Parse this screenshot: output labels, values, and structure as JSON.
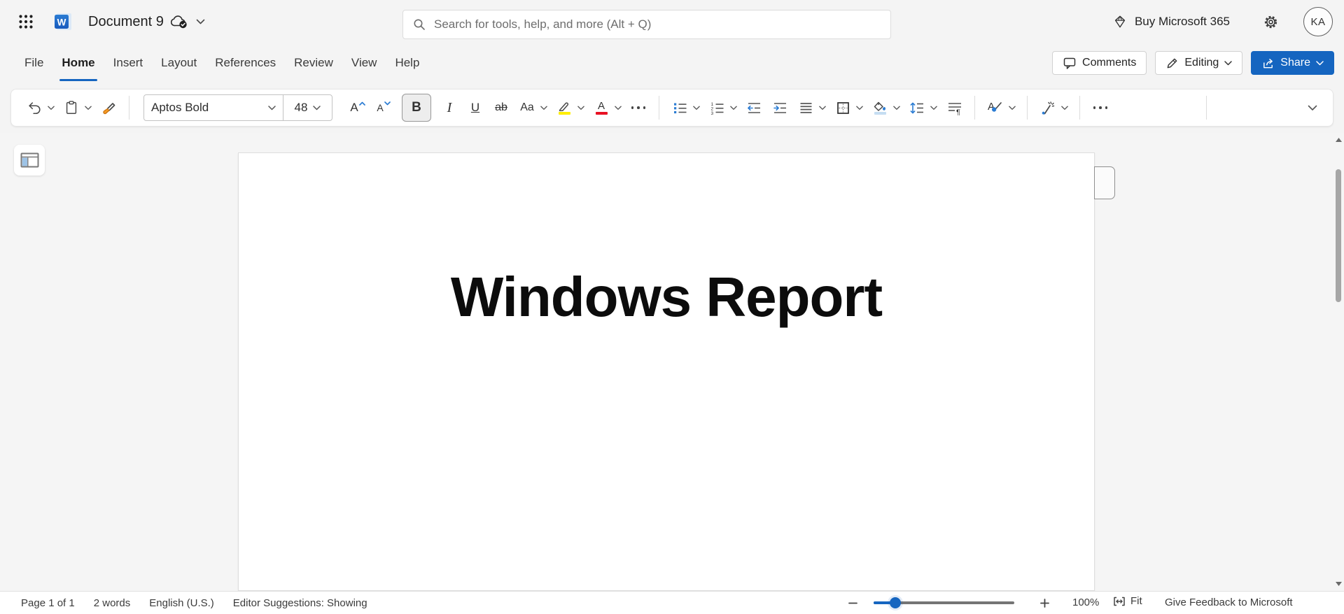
{
  "topbar": {
    "document_title": "Document 9",
    "search_placeholder": "Search for tools, help, and more (Alt + Q)",
    "buy_label": "Buy Microsoft 365",
    "avatar_initials": "KA"
  },
  "menubar": {
    "tabs": [
      {
        "label": "File"
      },
      {
        "label": "Home",
        "active": true
      },
      {
        "label": "Insert"
      },
      {
        "label": "Layout"
      },
      {
        "label": "References"
      },
      {
        "label": "Review"
      },
      {
        "label": "View"
      },
      {
        "label": "Help"
      }
    ],
    "comments_label": "Comments",
    "editing_label": "Editing",
    "share_label": "Share"
  },
  "ribbon": {
    "font_name": "Aptos Bold",
    "font_size": "48",
    "grow_font_glyph": "A",
    "shrink_font_glyph": "A",
    "bold_glyph": "B",
    "italic_glyph": "I",
    "underline_glyph": "U",
    "strikethrough_glyph": "ab",
    "change_case_glyph": "Aa",
    "font_color_glyph": "A",
    "paragraph_mark": "¶",
    "numbering_digits": [
      "1",
      "2",
      "3"
    ],
    "styles_glyph": "A"
  },
  "document": {
    "title_text": "Windows Report"
  },
  "statusbar": {
    "page_info": "Page 1 of 1",
    "word_count": "2 words",
    "language": "English (U.S.)",
    "editor_suggestions": "Editor Suggestions: Showing",
    "zoom_level": "100%",
    "fit_label": "Fit",
    "feedback_label": "Give Feedback to Microsoft",
    "zoom_slider_percent": 15
  },
  "colors": {
    "accent_blue": "#1565c0",
    "icon_blue": "#2b7cd3",
    "highlight_yellow": "#ffee00",
    "font_red": "#e81123",
    "shade_bar": "#c5ddf2",
    "word_blue_top": "#2b7cd3",
    "word_blue_bottom": "#185abd"
  },
  "icons": {
    "app-launcher-icon": "3x3 dot grid",
    "word-icon": "blue square with white W",
    "cloud-saved-icon": "cloud with check circle",
    "chevron-down-icon": "v chevron",
    "search-icon": "magnifier",
    "diamond-icon": "gem outline",
    "gear-icon": "settings gear",
    "comments-icon": "speech bubble",
    "editing-icon": "pencil",
    "share-icon": "box with arrow",
    "undo-icon": "curved left arrow",
    "paste-icon": "clipboard",
    "format-painter-icon": "brush with orange bristles",
    "highlight-icon": "pen over yellow bar",
    "font-color-icon": "A over red bar",
    "more-icon": "three dots",
    "bullets-icon": "blue squares with lines",
    "numbering-icon": "1 2 3 with lines",
    "decrease-indent-icon": "left arrow with lines",
    "increase-indent-icon": "right arrow with lines",
    "align-icon": "four justified lines",
    "borders-icon": "square with dashed cross",
    "shading-icon": "paint bucket over light-blue bar",
    "line-spacing-icon": "up-down arrow with lines",
    "paragraph-marks-icon": "lines with pilcrow",
    "styles-icon": "A with blue brush stroke",
    "magic-wand-icon": "pen with sparkles",
    "collapse-ribbon-icon": "v chevron",
    "pane-toggle-icon": "window with blue left panel",
    "zoom-out-icon": "minus",
    "zoom-in-icon": "plus",
    "fit-icon": "frame with left-right arrows",
    "scroll-up-icon": "triangle up",
    "scroll-down-icon": "triangle down"
  }
}
